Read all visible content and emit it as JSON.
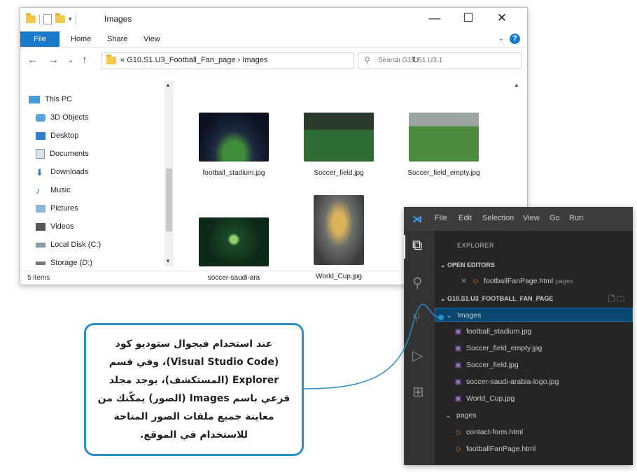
{
  "explorer": {
    "title": "Images",
    "menu": {
      "file": "File",
      "home": "Home",
      "share": "Share",
      "view": "View"
    },
    "address": {
      "parent": "G10.S1.U3_Football_Fan_page",
      "separator": "›",
      "current": "Images",
      "prefix": "«"
    },
    "search_placeholder": "Search G10.S1.U3.1",
    "nav_items": [
      {
        "label": "This PC",
        "icon": "pc-icon"
      },
      {
        "label": "3D Objects",
        "icon": "3d-objects-icon"
      },
      {
        "label": "Desktop",
        "icon": "desktop-icon"
      },
      {
        "label": "Documents",
        "icon": "documents-icon"
      },
      {
        "label": "Downloads",
        "icon": "downloads-icon"
      },
      {
        "label": "Music",
        "icon": "music-icon"
      },
      {
        "label": "Pictures",
        "icon": "pictures-icon"
      },
      {
        "label": "Videos",
        "icon": "videos-icon"
      },
      {
        "label": "Local Disk (C:)",
        "icon": "local-disk-icon"
      },
      {
        "label": "Storage (D:)",
        "icon": "storage-drive-icon"
      }
    ],
    "files": [
      {
        "name": "football_stadium.jpg"
      },
      {
        "name": "Soccer_field.jpg"
      },
      {
        "name": "Soccer_field_empty.jpg"
      },
      {
        "name": "soccer-saudi-ara"
      },
      {
        "name": "World_Cup.jpg"
      }
    ],
    "status": "5 items"
  },
  "vscode": {
    "menu": [
      "File",
      "Edit",
      "Selection",
      "View",
      "Go",
      "Run"
    ],
    "explorer_title": "EXPLORER",
    "open_editors_label": "OPEN EDITORS",
    "open_editor": {
      "file": "footballFanPage.html",
      "folder": "pages"
    },
    "project_label": "G10.S1.U3_FOOTBALL_FAN_PAGE",
    "images_folder": "Images",
    "image_files": [
      "football_stadium.jpg",
      "Soccer_field_empty.jpg",
      "Soccer_field.jpg",
      "soccer-saudi-arabia-logo.jpg",
      "World_Cup.jpg"
    ],
    "pages_folder": "pages",
    "page_files": [
      "contact-form.html",
      "footballFanPage.html"
    ]
  },
  "callout": {
    "text": "عند استخدام فيجوال ستوديو كود (Visual Studio Code)، وفي قسم Explorer (المستكشف)، يوجد مجلد فرعي باسم Images (الصور) يمكّنك من معاينة جميع ملفات الصور المتاحة للاستخدام في الموقع."
  },
  "colors": {
    "accent": "#1979ca",
    "vscode_bg": "#252526",
    "vscode_selection": "#094771",
    "callout_border": "#2b8ec6"
  }
}
